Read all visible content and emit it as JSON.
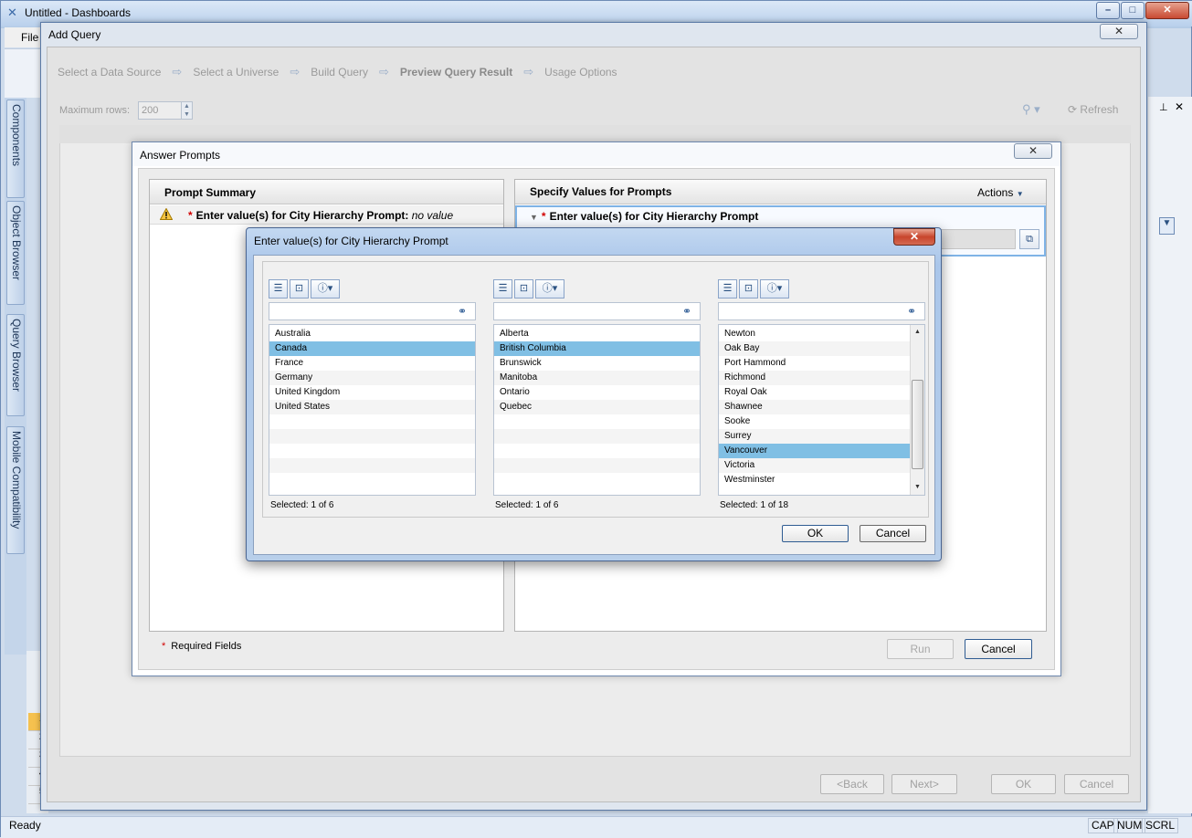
{
  "window": {
    "title": "Untitled - Dashboards"
  },
  "menu": {
    "file": "File"
  },
  "side_tabs": [
    "Components",
    "Object Browser",
    "Query Browser",
    "Mobile Compatibility"
  ],
  "row_numbers": [
    "1",
    "2",
    "3",
    "4",
    "5"
  ],
  "status": {
    "text": "Ready",
    "cap": "CAP",
    "num": "NUM",
    "scrl": "SCRL"
  },
  "add_query": {
    "title": "Add Query",
    "wizard_steps": [
      "Select a Data Source",
      "Select a Universe",
      "Build Query",
      "Preview Query Result",
      "Usage Options"
    ],
    "active_step": "Preview Query Result",
    "max_rows_label": "Maximum rows:",
    "max_rows_value": "200",
    "refresh": "Refresh",
    "back": "<Back",
    "next": "Next>",
    "ok": "OK",
    "cancel": "Cancel"
  },
  "answer_prompts": {
    "title": "Answer Prompts",
    "summary_header": "Prompt Summary",
    "summary_prompt": "Enter value(s) for City Hierarchy Prompt:",
    "summary_value": "no value",
    "specify_header": "Specify Values for Prompts",
    "actions": "Actions",
    "prompt_name": "Enter value(s) for City Hierarchy Prompt",
    "required_note": "Required Fields",
    "run": "Run",
    "cancel": "Cancel"
  },
  "enter_values": {
    "title": "Enter value(s) for City Hierarchy Prompt",
    "columns": [
      {
        "items": [
          "Australia",
          "Canada",
          "France",
          "Germany",
          "United Kingdom",
          "United States"
        ],
        "selected": "Canada",
        "selected_text": "Selected: 1 of 6"
      },
      {
        "items": [
          "Alberta",
          "British Columbia",
          "Brunswick",
          "Manitoba",
          "Ontario",
          "Quebec"
        ],
        "selected": "British Columbia",
        "selected_text": "Selected: 1 of 6"
      },
      {
        "items": [
          "Newton",
          "Oak Bay",
          "Port Hammond",
          "Richmond",
          "Royal Oak",
          "Shawnee",
          "Sooke",
          "Surrey",
          "Vancouver",
          "Victoria",
          "Westminster"
        ],
        "selected": "Vancouver",
        "selected_text": "Selected: 1 of 18"
      }
    ],
    "ok": "OK",
    "cancel": "Cancel"
  }
}
